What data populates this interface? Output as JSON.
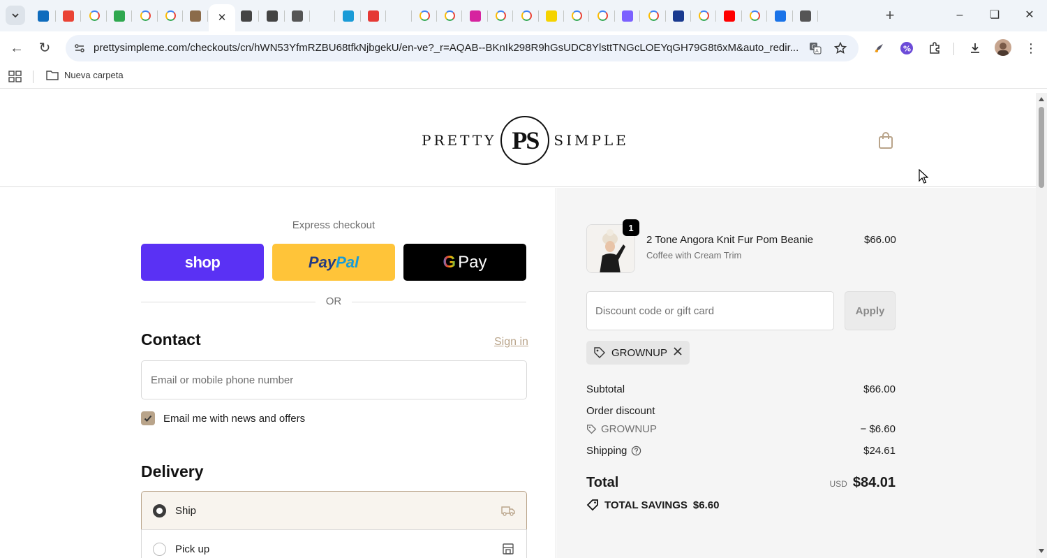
{
  "browser": {
    "url": "prettysimpleme.com/checkouts/cn/hWN53YfmRZBU68tfkNjbgekU/en-ve?_r=AQAB--BKnIk298R9hGsUDC8YlsttTNGcLOEYqGH79G8t6xM&auto_redir...",
    "bookmark_folder": "Nueva carpeta",
    "tabs": [
      {
        "icon": "outlook-icon",
        "color": "#0f6cbd"
      },
      {
        "icon": "gmail-icon",
        "color": "#ea4335"
      },
      {
        "icon": "google-icon",
        "color": "#4285f4"
      },
      {
        "icon": "leaf-icon",
        "color": "#2fa84f"
      },
      {
        "icon": "google-icon",
        "color": "#4285f4"
      },
      {
        "icon": "google-icon",
        "color": "#4285f4"
      },
      {
        "icon": "pretty-simple-icon",
        "color": "#8b6b4a"
      },
      {
        "icon": "close-icon",
        "color": "#333333",
        "active": true
      },
      {
        "icon": "chatgpt-icon",
        "color": "#444444"
      },
      {
        "icon": "font-icon",
        "color": "#444444"
      },
      {
        "icon": "globe-icon",
        "color": "#555555"
      },
      {
        "icon": "blank-icon",
        "color": "#ffffff"
      },
      {
        "icon": "save-icon",
        "color": "#1a9bd7"
      },
      {
        "icon": "red-circle-icon",
        "color": "#e53935"
      },
      {
        "icon": "blank-icon",
        "color": "#ffffff"
      },
      {
        "icon": "google-icon",
        "color": "#4285f4"
      },
      {
        "icon": "google-icon",
        "color": "#4285f4"
      },
      {
        "icon": "instagram-icon",
        "color": "#d6249f"
      },
      {
        "icon": "google-icon",
        "color": "#4285f4"
      },
      {
        "icon": "google-icon",
        "color": "#4285f4"
      },
      {
        "icon": "yellow-logo-icon",
        "color": "#f5d300"
      },
      {
        "icon": "google-icon",
        "color": "#4285f4"
      },
      {
        "icon": "google-icon",
        "color": "#4285f4"
      },
      {
        "icon": "feather-icon",
        "color": "#7b61ff"
      },
      {
        "icon": "google-icon",
        "color": "#4285f4"
      },
      {
        "icon": "delta-icon",
        "color": "#1a3a8f"
      },
      {
        "icon": "google-icon",
        "color": "#4285f4"
      },
      {
        "icon": "youtube-icon",
        "color": "#ff0000"
      },
      {
        "icon": "google-icon",
        "color": "#4285f4"
      },
      {
        "icon": "grid-app-icon",
        "color": "#1a73e8"
      },
      {
        "icon": "chrome-icon",
        "color": "#555555"
      }
    ]
  },
  "store": {
    "logo_left": "PRETTY",
    "logo_mark": "PS",
    "logo_right": "SIMPLE"
  },
  "express": {
    "title": "Express checkout",
    "shop_label": "shop",
    "paypal_label_1": "Pay",
    "paypal_label_2": "Pal",
    "gpay_g": "G",
    "gpay_label": "Pay",
    "or_label": "OR"
  },
  "contact": {
    "title": "Contact",
    "signin_label": "Sign in",
    "email_placeholder": "Email or mobile phone number",
    "newsletter_label": "Email me with news and offers",
    "newsletter_checked": true
  },
  "delivery": {
    "title": "Delivery",
    "options": [
      {
        "label": "Ship",
        "selected": true,
        "icon": "truck-icon"
      },
      {
        "label": "Pick up",
        "selected": false,
        "icon": "store-icon"
      }
    ]
  },
  "summary": {
    "item": {
      "quantity": "1",
      "name": "2 Tone Angora Knit Fur Pom Beanie",
      "variant": "Coffee with Cream Trim",
      "price": "$66.00"
    },
    "discount_placeholder": "Discount code or gift card",
    "apply_label": "Apply",
    "applied_code": "GROWNUP",
    "subtotal_label": "Subtotal",
    "subtotal_value": "$66.00",
    "order_discount_label": "Order discount",
    "discount_code": "GROWNUP",
    "discount_value": "− $6.60",
    "shipping_label": "Shipping",
    "shipping_value": "$24.61",
    "total_label": "Total",
    "total_currency": "USD",
    "total_value": "$84.01",
    "savings_label": "TOTAL SAVINGS",
    "savings_value": "$6.60"
  },
  "colors": {
    "accent": "#b9a48a",
    "shop_pay": "#5a31f4",
    "paypal": "#ffc439",
    "gpay": "#000000"
  }
}
